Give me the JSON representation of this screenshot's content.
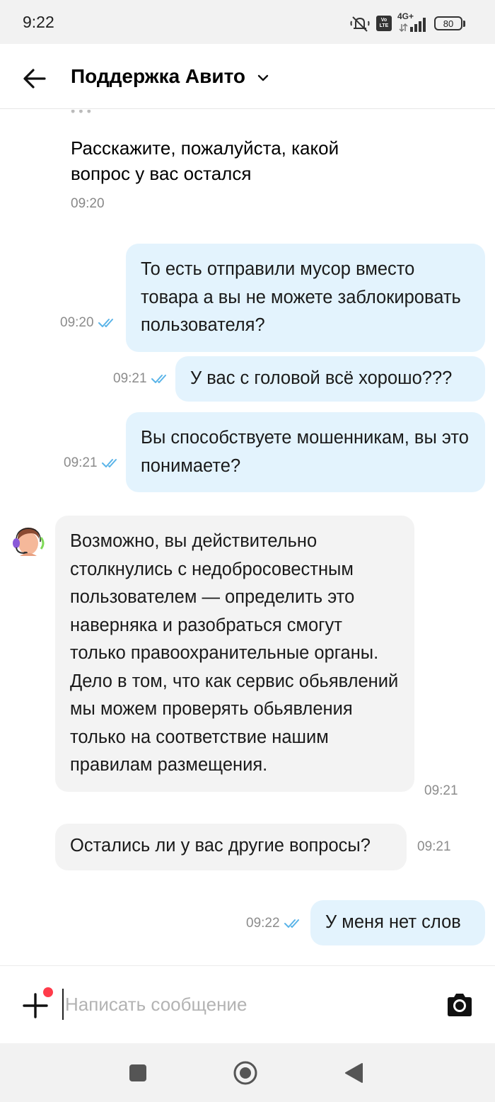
{
  "status_bar": {
    "time": "9:22",
    "network": "4G+",
    "volte": "Vo LTE",
    "battery": "80"
  },
  "header": {
    "title": "Поддержка Авито"
  },
  "messages": [
    {
      "id": "m1",
      "direction": "incoming",
      "style": "plain",
      "text": "Расскажите, пожалуйста, какой вопрос у вас остался",
      "time": "09:20"
    },
    {
      "id": "m2",
      "direction": "outgoing",
      "text": "То есть отправили мусор вместо товара а вы не можете заблокировать пользователя?",
      "time": "09:20",
      "read": true
    },
    {
      "id": "m3",
      "direction": "outgoing",
      "text": "У вас с головой всё хорошо???",
      "time": "09:21",
      "read": true
    },
    {
      "id": "m4",
      "direction": "outgoing",
      "text": "Вы способствуете мошенникам, вы это понимаете?",
      "time": "09:21",
      "read": true
    },
    {
      "id": "m5",
      "direction": "incoming",
      "text": "Возможно, вы действительно столкнулись с недобросовестным пользователем — определить это наверняка и разобраться смогут только правоохранительные органы. Дело в том, что как сервис обьявлений мы можем проверять обьявления  только на соответствие нашим правилам размещения.",
      "time": "09:21"
    },
    {
      "id": "m6",
      "direction": "incoming",
      "text": "Остались ли у вас другие вопросы?",
      "time": "09:21"
    },
    {
      "id": "m7",
      "direction": "outgoing",
      "text": "У меня нет слов",
      "time": "09:22",
      "read": true
    }
  ],
  "composer": {
    "placeholder": "Написать сообщение"
  },
  "colors": {
    "outgoing_bubble": "#e3f3fd",
    "incoming_bubble": "#f3f3f3",
    "read_check": "#5ab4e8",
    "attach_dot": "#ff3b4a"
  },
  "icons": [
    "back-arrow-icon",
    "chevron-down-icon",
    "double-check-icon",
    "support-avatar-icon",
    "plus-icon",
    "camera-icon",
    "square-icon",
    "circle-home-icon",
    "triangle-back-icon"
  ]
}
